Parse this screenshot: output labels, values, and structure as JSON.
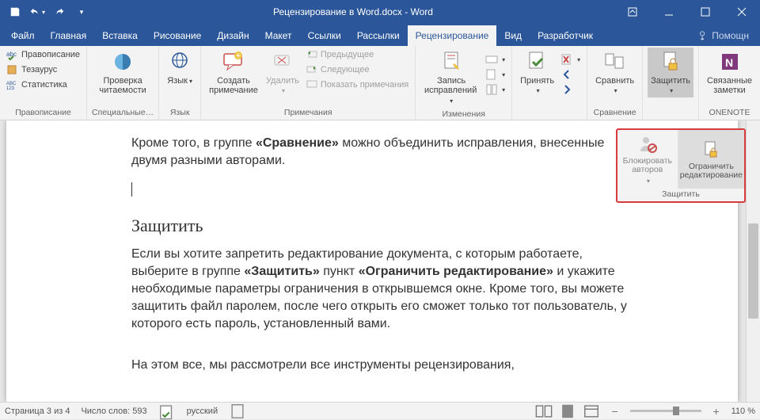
{
  "title": "Рецензирование в Word.docx - Word",
  "tabs": [
    "Файл",
    "Главная",
    "Вставка",
    "Рисование",
    "Дизайн",
    "Макет",
    "Ссылки",
    "Рассылки",
    "Рецензирование",
    "Вид",
    "Разработчик"
  ],
  "active_tab_index": 8,
  "help_placeholder": "Помощн",
  "ribbon": {
    "proofing": {
      "spelling": "Правописание",
      "thesaurus": "Тезаурус",
      "stats": "Статистика",
      "group": "Правописание"
    },
    "special": {
      "readability": "Проверка\nчитаемости",
      "group": "Специальные…"
    },
    "language": {
      "btn": "Язык",
      "group": "Язык"
    },
    "comments": {
      "new": "Создать\nпримечание",
      "delete": "Удалить",
      "prev": "Предыдущее",
      "next": "Следующее",
      "show": "Показать примечания",
      "group": "Примечания"
    },
    "tracking": {
      "track": "Запись\nисправлений",
      "group": "Изменения"
    },
    "changes": {
      "accept": "Принять",
      "group": " "
    },
    "compare": {
      "compare": "Сравнить",
      "group": "Сравнение"
    },
    "protect": {
      "protect": "Защитить",
      "group": " "
    },
    "onenote": {
      "linked": "Связанные\nзаметки",
      "group": "ONENOTE"
    }
  },
  "popover": {
    "block": "Блокировать\nавторов",
    "restrict": "Ограничить\nредактирование",
    "group": "Защитить"
  },
  "doc": {
    "p1_a": "Кроме того, в группе ",
    "p1_b": "«Сравнение»",
    "p1_c": " можно объединить исправления, внесенные двумя разными авторами.",
    "h2": "Защитить",
    "p2_a": "Если вы хотите запретить редактирование документа, с которым работаете, выберите в группе ",
    "p2_b": "«Защитить»",
    "p2_c": " пункт ",
    "p2_d": "«Ограничить редактирование»",
    "p2_e": " и укажите необходимые параметры ограничения в открывшемся окне. Кроме того, вы можете защитить файл паролем, после чего открыть его сможет только тот пользователь, у которого есть пароль, установленный вами.",
    "p3": "На этом все, мы рассмотрели все инструменты рецензирования,"
  },
  "status": {
    "page": "Страница 3 из 4",
    "words": "Число слов: 593",
    "lang": "русский",
    "zoom": "110 %"
  }
}
